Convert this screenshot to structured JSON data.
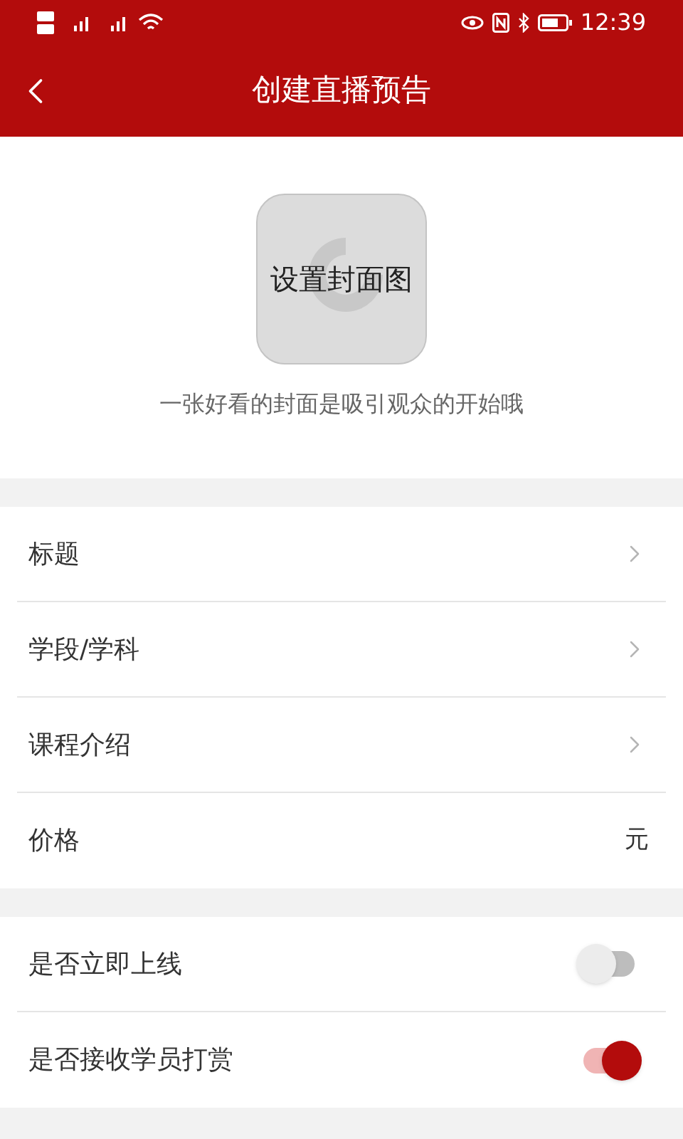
{
  "status_bar": {
    "time": "12:39"
  },
  "nav": {
    "title": "创建直播预告"
  },
  "cover": {
    "button": "设置封面图",
    "hint": "一张好看的封面是吸引观众的开始哦"
  },
  "fields": [
    {
      "label": "标题",
      "kind": "link"
    },
    {
      "label": "学段/学科",
      "kind": "link"
    },
    {
      "label": "课程介绍",
      "kind": "link"
    },
    {
      "label": "价格",
      "kind": "unit",
      "unit": "元"
    }
  ],
  "switches": [
    {
      "label": "是否立即上线",
      "on": false
    },
    {
      "label": "是否接收学员打赏",
      "on": true
    }
  ]
}
